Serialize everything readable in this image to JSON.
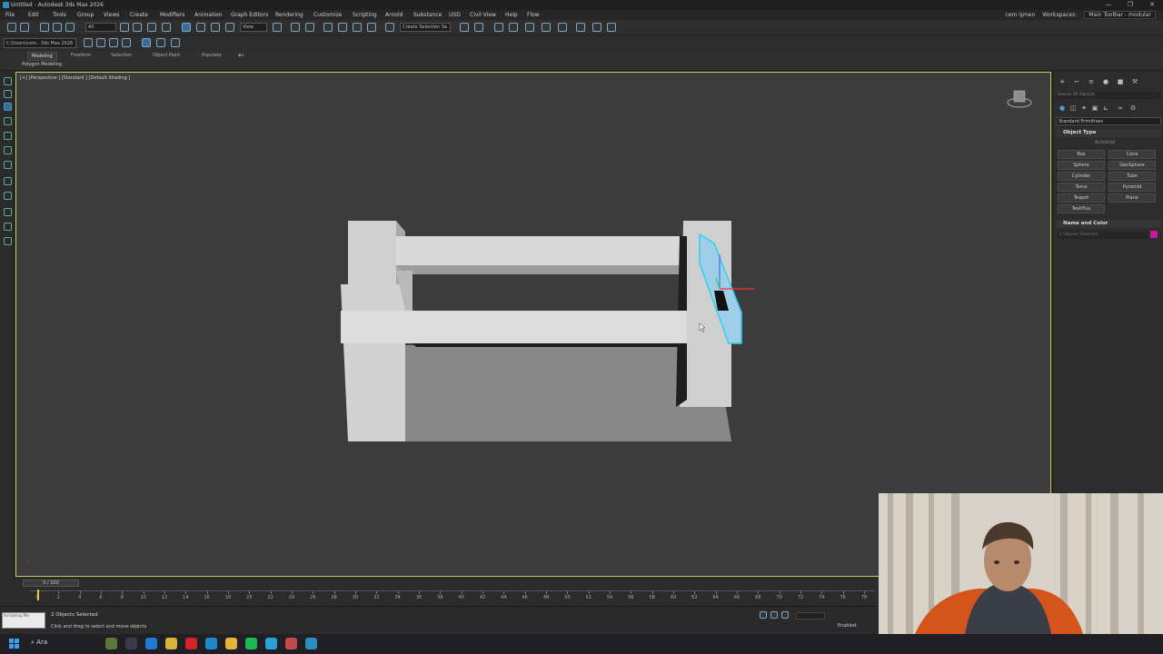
{
  "window": {
    "title": "Untitled - Autodesk 3ds Max 2026",
    "controls": [
      "—",
      "❐",
      "✕"
    ]
  },
  "menu": {
    "items": [
      "File",
      "Edit",
      "Tools",
      "Group",
      "Views",
      "Create",
      "Modifiers",
      "Animation",
      "Graph Editors",
      "Rendering",
      "Customize",
      "Scripting",
      "Arnold",
      "Substance",
      "USD",
      "Civil View",
      "Help",
      "Flow"
    ],
    "user": "cem işmen",
    "workspaces_label": "Workspaces:",
    "workspace": "Main Toolbar - modular"
  },
  "toolbar": {
    "filter": "All",
    "view_dd": "View",
    "selection_set": "Create Selection Se"
  },
  "toolbar2": {
    "path": "C:\\Users\\cem...3ds Max 2026"
  },
  "ribbon": {
    "tabs": [
      "Modeling",
      "Freeform",
      "Selection",
      "Object Paint",
      "Populate"
    ],
    "sub": "Polygon Modeling"
  },
  "viewport": {
    "label": "[+] [Perspective ] [Standard ] [Default Shading ]",
    "border_color": "#c8c85a"
  },
  "command_panel": {
    "search_placeholder": "Search All Objects",
    "category": "Standard Primitives",
    "object_type_title": "Object Type",
    "autogrid": "AutoGrid",
    "primitives": [
      "Box",
      "Cone",
      "Sphere",
      "GeoSphere",
      "Cylinder",
      "Tube",
      "Torus",
      "Pyramid",
      "Teapot",
      "Plane",
      "TextPlus"
    ],
    "name_color_title": "Name and Color",
    "name_value": "2 Objects Selected",
    "object_color": "#c4199a"
  },
  "timeline": {
    "frame_display": "0 / 100",
    "ticks": [
      "0",
      "2",
      "4",
      "6",
      "8",
      "10",
      "12",
      "14",
      "16",
      "18",
      "20",
      "22",
      "24",
      "26",
      "28",
      "30",
      "32",
      "34",
      "36",
      "38",
      "40",
      "42",
      "44",
      "46",
      "48",
      "50",
      "52",
      "54",
      "56",
      "58",
      "60",
      "62",
      "64",
      "66",
      "68",
      "70",
      "72",
      "74",
      "76",
      "78"
    ]
  },
  "status": {
    "maxscript": "Scripting Mo",
    "selection": "2 Objects Selected",
    "prompt": "Click and drag to select and move objects",
    "enabled": "Enabled:"
  },
  "taskbar": {
    "search": "Ara",
    "apps": [
      {
        "name": "frog-app-icon",
        "color": "#5a7a3a"
      },
      {
        "name": "task-view-icon",
        "color": "#3a3a4a"
      },
      {
        "name": "edge-app-icon",
        "color": "#1f7ad6"
      },
      {
        "name": "chrome-app-icon",
        "color": "#d8b33a"
      },
      {
        "name": "opera-app-icon",
        "color": "#d3242c"
      },
      {
        "name": "browser-app-icon",
        "color": "#1e88c8"
      },
      {
        "name": "folder-app-icon",
        "color": "#e5b43b"
      },
      {
        "name": "spotify-app-icon",
        "color": "#1db954"
      },
      {
        "name": "telegram-app-icon",
        "color": "#2aa1da"
      },
      {
        "name": "davinci-app-icon",
        "color": "#c24a4a"
      },
      {
        "name": "3dsmax-app-icon",
        "color": "#2a8fbf"
      }
    ]
  }
}
